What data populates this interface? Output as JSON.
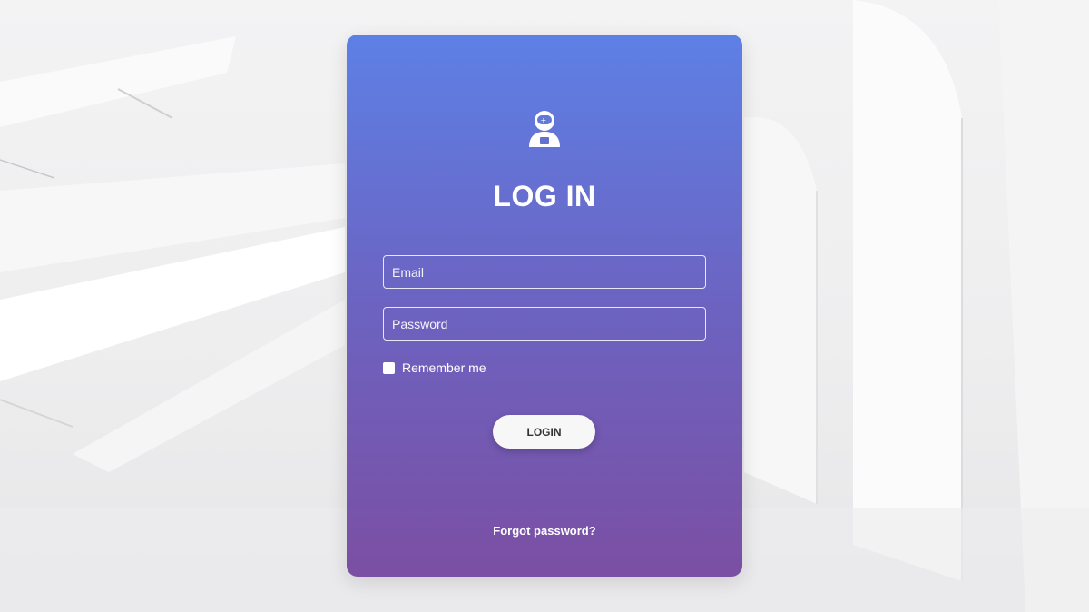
{
  "login_card": {
    "icon": "astronaut-icon",
    "title": "LOG IN",
    "email_placeholder": "Email",
    "password_placeholder": "Password",
    "remember_label": "Remember me",
    "remember_checked": false,
    "login_button_label": "LOGIN",
    "forgot_link": "Forgot password?"
  },
  "colors": {
    "gradient_top": "#5d80e6",
    "gradient_bottom": "#7b4fa3",
    "text": "#ffffff",
    "button_bg": "#f7f7f8"
  }
}
